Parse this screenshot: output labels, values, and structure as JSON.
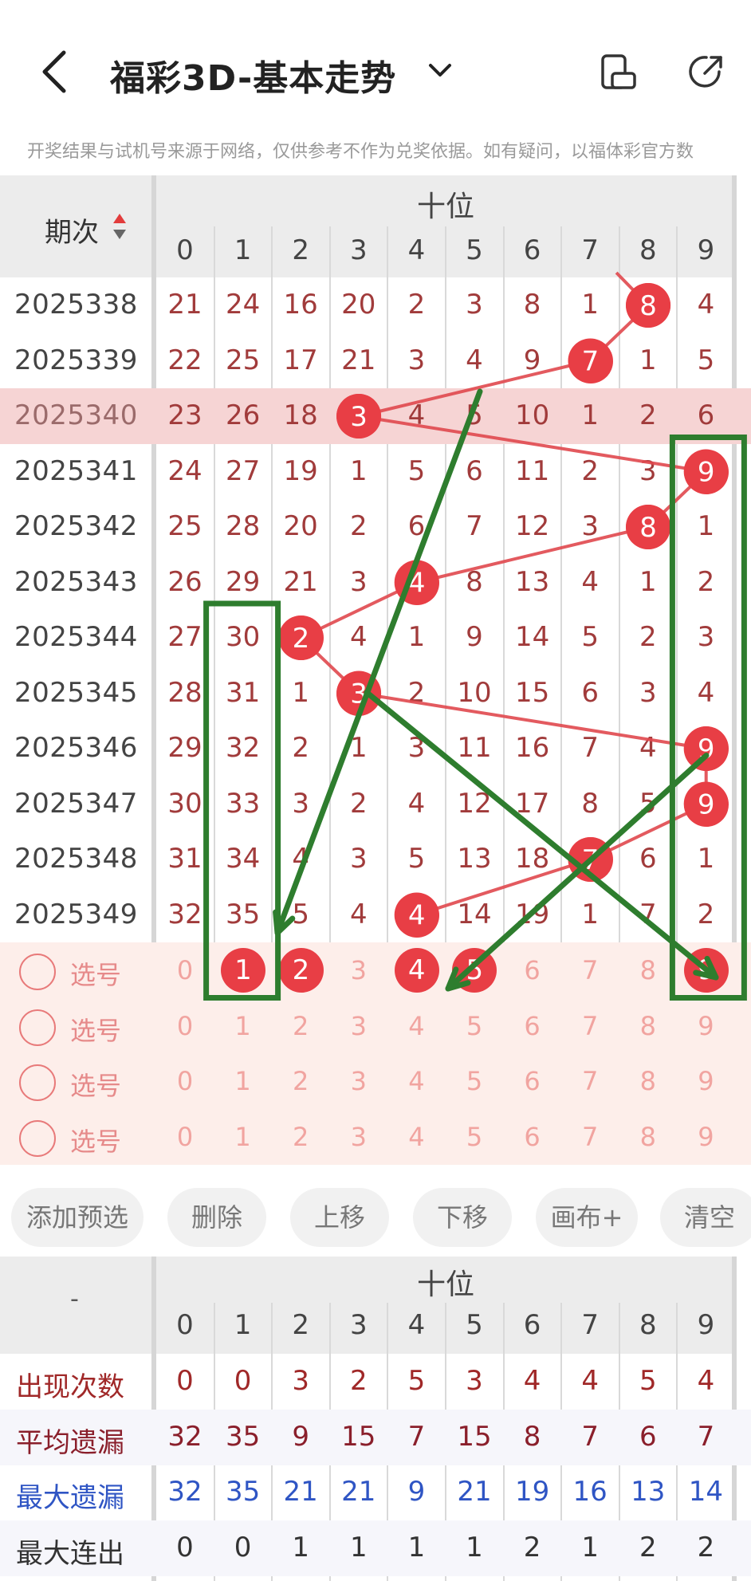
{
  "header": {
    "title": "福彩3D-基本走势",
    "notice": "开奖结果与试机号来源于网络，仅供参考不作为兑奖依据。如有疑问，以福体彩官方数"
  },
  "grid": {
    "period_header": "期次",
    "position_title": "十位",
    "digits": [
      "0",
      "1",
      "2",
      "3",
      "4",
      "5",
      "6",
      "7",
      "8",
      "9"
    ],
    "rows": [
      {
        "period": "2025338",
        "values": [
          "21",
          "24",
          "16",
          "20",
          "2",
          "3",
          "8",
          "1",
          "8",
          "4"
        ],
        "hit": 8
      },
      {
        "period": "2025339",
        "values": [
          "22",
          "25",
          "17",
          "21",
          "3",
          "4",
          "9",
          "7",
          "1",
          "5"
        ],
        "hit": 7
      },
      {
        "period": "2025340",
        "values": [
          "23",
          "26",
          "18",
          "3",
          "4",
          "5",
          "10",
          "1",
          "2",
          "6"
        ],
        "hit": 3
      },
      {
        "period": "2025341",
        "values": [
          "24",
          "27",
          "19",
          "1",
          "5",
          "6",
          "11",
          "2",
          "3",
          "9"
        ],
        "hit": 9
      },
      {
        "period": "2025342",
        "values": [
          "25",
          "28",
          "20",
          "2",
          "6",
          "7",
          "12",
          "3",
          "8",
          "1"
        ],
        "hit": 8
      },
      {
        "period": "2025343",
        "values": [
          "26",
          "29",
          "21",
          "3",
          "4",
          "8",
          "13",
          "4",
          "1",
          "2"
        ],
        "hit": 4
      },
      {
        "period": "2025344",
        "values": [
          "27",
          "30",
          "2",
          "4",
          "1",
          "9",
          "14",
          "5",
          "2",
          "3"
        ],
        "hit": 2
      },
      {
        "period": "2025345",
        "values": [
          "28",
          "31",
          "1",
          "3",
          "2",
          "10",
          "15",
          "6",
          "3",
          "4"
        ],
        "hit": 3
      },
      {
        "period": "2025346",
        "values": [
          "29",
          "32",
          "2",
          "1",
          "3",
          "11",
          "16",
          "7",
          "4",
          "9"
        ],
        "hit": 9
      },
      {
        "period": "2025347",
        "values": [
          "30",
          "33",
          "3",
          "2",
          "4",
          "12",
          "17",
          "8",
          "5",
          "9"
        ],
        "hit": 9
      },
      {
        "period": "2025348",
        "values": [
          "31",
          "34",
          "4",
          "3",
          "5",
          "13",
          "18",
          "7",
          "6",
          "1"
        ],
        "hit": 7
      },
      {
        "period": "2025349",
        "values": [
          "32",
          "35",
          "5",
          "4",
          "4",
          "14",
          "19",
          "1",
          "7",
          "2"
        ],
        "hit": 4
      }
    ],
    "picks": [
      {
        "label": "选号",
        "numbers": [
          "0",
          "1",
          "2",
          "3",
          "4",
          "5",
          "6",
          "7",
          "8",
          "9"
        ],
        "selected": [
          1,
          2,
          4,
          5,
          9
        ]
      },
      {
        "label": "选号",
        "numbers": [
          "0",
          "1",
          "2",
          "3",
          "4",
          "5",
          "6",
          "7",
          "8",
          "9"
        ],
        "selected": []
      },
      {
        "label": "选号",
        "numbers": [
          "0",
          "1",
          "2",
          "3",
          "4",
          "5",
          "6",
          "7",
          "8",
          "9"
        ],
        "selected": []
      },
      {
        "label": "选号",
        "numbers": [
          "0",
          "1",
          "2",
          "3",
          "4",
          "5",
          "6",
          "7",
          "8",
          "9"
        ],
        "selected": []
      }
    ]
  },
  "buttons": {
    "add": "添加预选",
    "delete": "删除",
    "up": "上移",
    "down": "下移",
    "canvas": "画布+",
    "clear": "清空"
  },
  "stats": {
    "corner": "-",
    "position_title": "十位",
    "digits": [
      "0",
      "1",
      "2",
      "3",
      "4",
      "5",
      "6",
      "7",
      "8",
      "9"
    ],
    "rows": [
      {
        "label": "出现次数",
        "color": "#a02828",
        "values": [
          "0",
          "0",
          "3",
          "2",
          "5",
          "3",
          "4",
          "4",
          "5",
          "4"
        ]
      },
      {
        "label": "平均遗漏",
        "color": "#8a1f2b",
        "values": [
          "32",
          "35",
          "9",
          "15",
          "7",
          "15",
          "8",
          "7",
          "6",
          "7"
        ]
      },
      {
        "label": "最大遗漏",
        "color": "#2f55c4",
        "values": [
          "32",
          "35",
          "21",
          "21",
          "9",
          "21",
          "19",
          "16",
          "13",
          "14"
        ]
      },
      {
        "label": "最大连出",
        "color": "#333333",
        "values": [
          "0",
          "0",
          "1",
          "1",
          "1",
          "1",
          "2",
          "1",
          "2",
          "2"
        ]
      }
    ]
  },
  "colors": {
    "ball": "#e83e45",
    "trend_line": "#e0484e",
    "annotation": "#2e7d2e",
    "highlight_row": "#f6d4d4",
    "pick_bg": "#fdeeea"
  }
}
